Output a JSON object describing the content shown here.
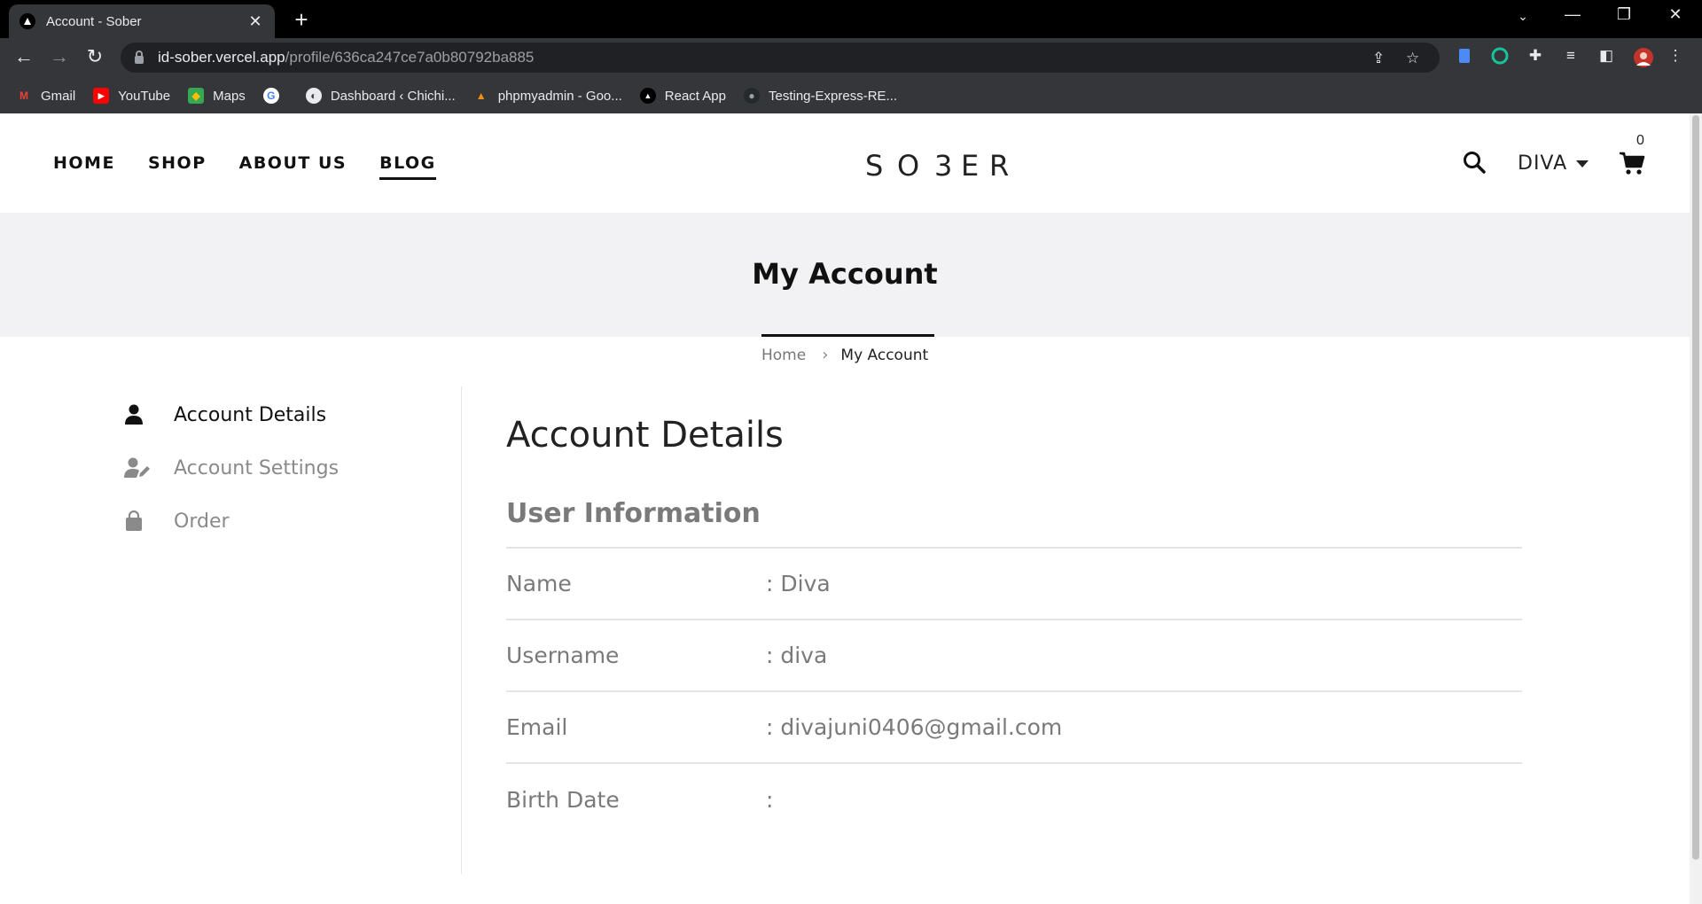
{
  "browser": {
    "tab_title": "Account - Sober",
    "new_tab_glyph": "+",
    "close_glyph": "✕",
    "url_host": "id-sober.vercel.app",
    "url_path": "/profile/636ca247ce7a0b80792ba885",
    "bookmarks": [
      {
        "label": "Gmail",
        "icon": "gmail-icon"
      },
      {
        "label": "YouTube",
        "icon": "youtube-icon"
      },
      {
        "label": "Maps",
        "icon": "maps-icon"
      },
      {
        "label": "",
        "icon": "google-icon"
      },
      {
        "label": "Dashboard ‹ Chichi...",
        "icon": "globe-icon"
      },
      {
        "label": "phpmyadmin - Goo...",
        "icon": "phpmyadmin-icon"
      },
      {
        "label": "React App",
        "icon": "react-app-icon"
      },
      {
        "label": "Testing-Express-RE...",
        "icon": "github-icon"
      }
    ]
  },
  "site": {
    "menu": [
      "HOME",
      "SHOP",
      "ABOUT US",
      "BLOG"
    ],
    "active_menu": "BLOG",
    "logo": "SO3ER",
    "user_name": "DIVA",
    "cart_count": "0"
  },
  "hero": {
    "title": "My Account",
    "breadcrumb_home": "Home",
    "breadcrumb_sep": "›",
    "breadcrumb_current": "My Account"
  },
  "sidebar": {
    "items": [
      {
        "label": "Account Details",
        "icon": "user-icon",
        "active": true
      },
      {
        "label": "Account Settings",
        "icon": "user-edit-icon",
        "active": false
      },
      {
        "label": "Order",
        "icon": "shopping-bag-icon",
        "active": false
      }
    ]
  },
  "content": {
    "title": "Account Details",
    "section": "User Information",
    "rows": [
      {
        "label": "Name",
        "value": ": Diva"
      },
      {
        "label": "Username",
        "value": ": diva"
      },
      {
        "label": "Email",
        "value": ": divajuni0406@gmail.com"
      },
      {
        "label": "Birth Date",
        "value": ":"
      }
    ]
  },
  "colors": {
    "browser_dark": "#35363a",
    "hero_bg": "#f2f2f4",
    "text_dark": "#111111",
    "text_muted": "#7a7a7a"
  }
}
